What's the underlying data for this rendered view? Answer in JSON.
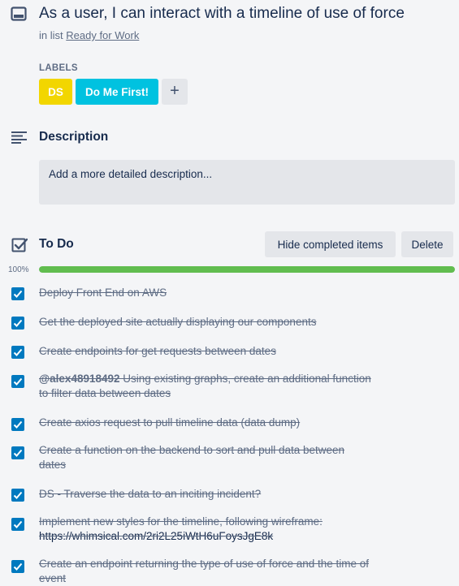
{
  "header": {
    "title": "As a user, I can interact with a timeline of use of force",
    "in_list_prefix": "in list",
    "list_name": "Ready for Work"
  },
  "labels": {
    "heading": "LABELS",
    "items": [
      {
        "text": "DS",
        "color": "#f2d600"
      },
      {
        "text": "Do Me First!",
        "color": "#00c2e0"
      }
    ],
    "add_symbol": "+"
  },
  "description": {
    "heading": "Description",
    "placeholder": "Add a more detailed description..."
  },
  "checklist": {
    "heading": "To Do",
    "hide_button": "Hide completed items",
    "delete_button": "Delete",
    "progress_label": "100%",
    "progress": 1.0,
    "progress_color": "#61bd4f",
    "items": [
      {
        "line1": "Deploy Front End on AWS",
        "checked": true
      },
      {
        "line1": "Get the deployed site actually displaying our components",
        "checked": true
      },
      {
        "line1": "Create endpoints for get requests between dates",
        "checked": true
      },
      {
        "mention": "@alex48918492",
        "line1": " Using existing graphs, create an additional function",
        "line2": "to filter data between dates",
        "checked": true
      },
      {
        "line1": "Create axios request to pull timeline data (data dump)",
        "checked": true
      },
      {
        "line1": "Create a function on the backend to sort and pull data between",
        "line2": "dates",
        "checked": true
      },
      {
        "line1": "DS - Traverse the data to an inciting incident?",
        "checked": true
      },
      {
        "line1": "Implement new styles for the timeline, following wireframe:",
        "url": "https://whimsical.com/2ri2L25iWtH6uFoysJgE8k",
        "checked": true
      },
      {
        "line1": "Create an endpoint returning the type of use of force and the time of",
        "line2": "event",
        "checked": true
      }
    ]
  },
  "colors": {
    "checkbox": "#0079bf",
    "text": "#172b4d",
    "muted": "#5e6c84"
  }
}
